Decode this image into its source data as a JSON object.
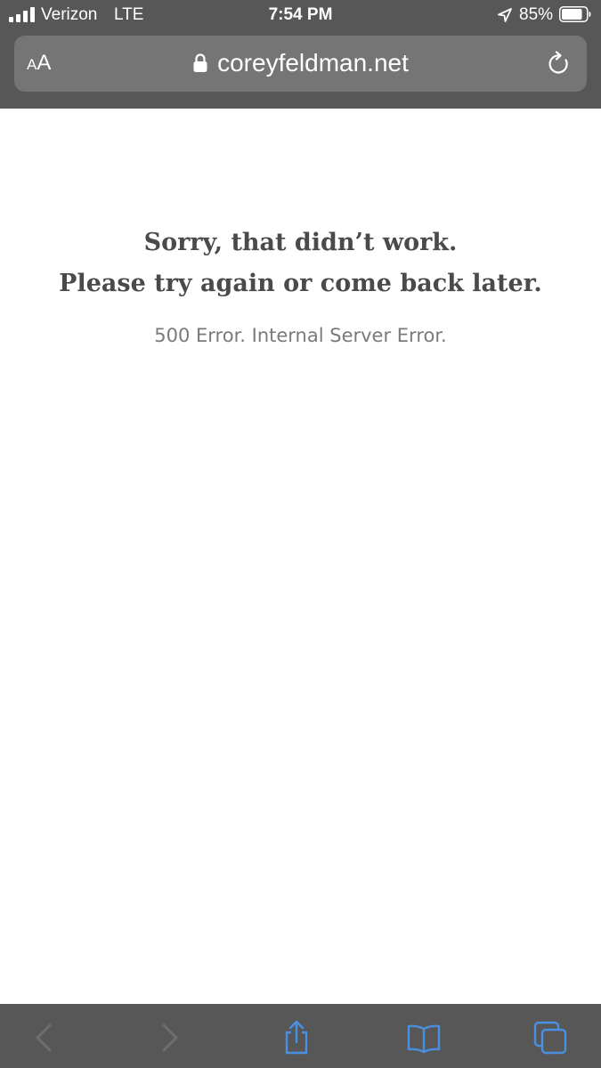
{
  "status_bar": {
    "carrier": "Verizon",
    "network": "LTE",
    "time": "7:54 PM",
    "battery_percent": "85%",
    "battery_level": 0.85,
    "icons": [
      "signal-icon",
      "location-arrow-icon",
      "battery-icon"
    ]
  },
  "browser": {
    "reader_label_large": "A",
    "reader_label_small": "A",
    "url": "coreyfeldman.net",
    "icons": [
      "lock-icon",
      "reload-icon"
    ]
  },
  "page": {
    "heading_line1": "Sorry, that didn’t work.",
    "heading_line2": "Please try again or come back later.",
    "error_detail": "500 Error. Internal Server Error."
  },
  "toolbar": {
    "icons": [
      "back-icon",
      "forward-icon",
      "share-icon",
      "bookmarks-icon",
      "tabs-icon"
    ],
    "back_enabled": false,
    "forward_enabled": false
  },
  "colors": {
    "chrome_background": "#575757",
    "address_field": "#757575",
    "heading_text": "#4a4a4a",
    "detail_text": "#7a7a7a",
    "toolbar_active": "#4a90e2",
    "toolbar_disabled": "#6e6e6e"
  }
}
